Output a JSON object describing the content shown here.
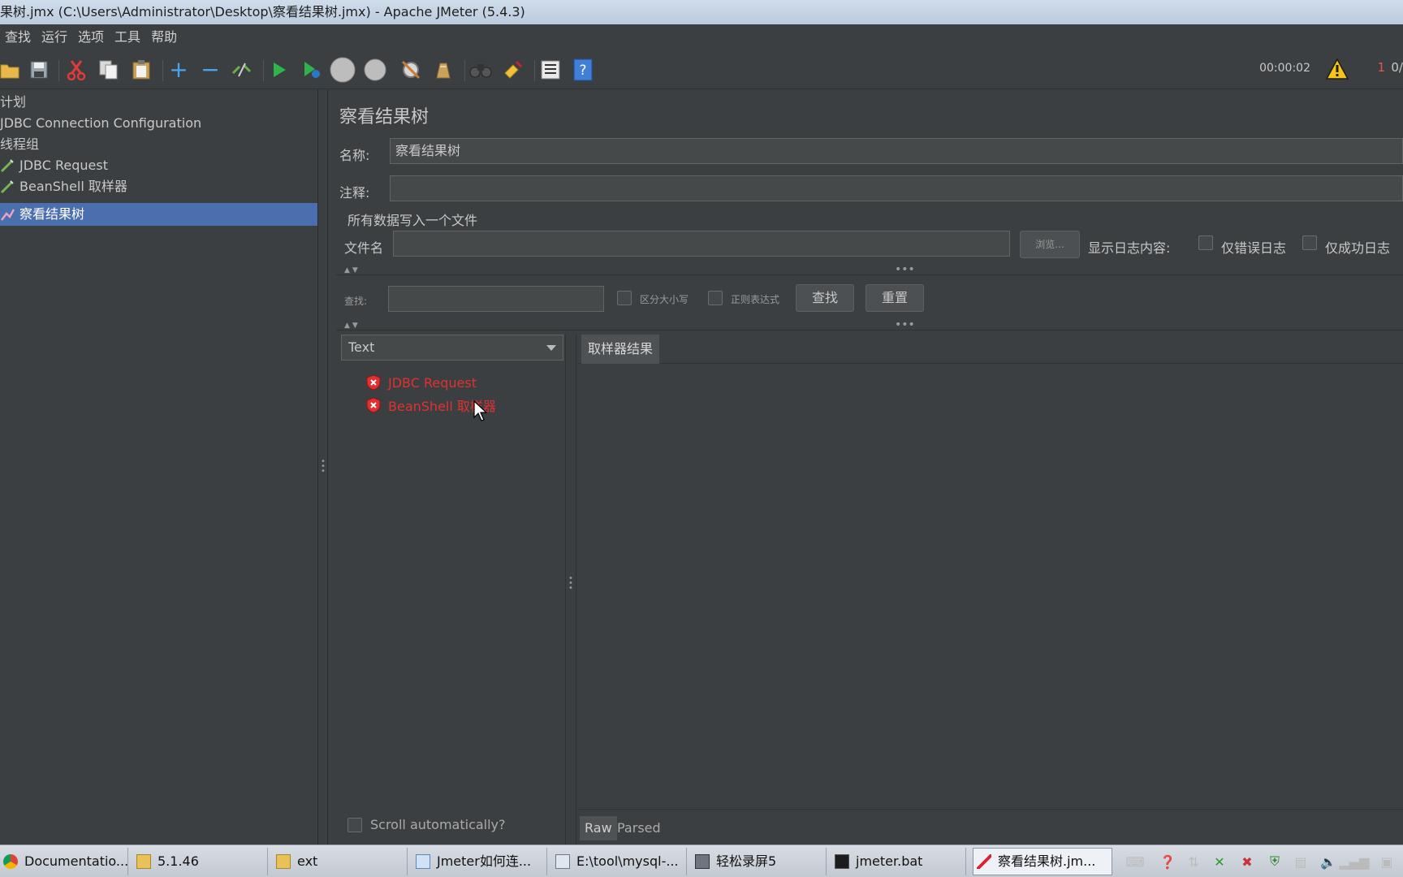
{
  "window": {
    "title": "果树.jmx (C:\\Users\\Administrator\\Desktop\\察看结果树.jmx) - Apache JMeter (5.4.3)"
  },
  "menu": [
    "查找",
    "运行",
    "选项",
    "工具",
    "帮助"
  ],
  "toolbar": {
    "timer": "00:00:02",
    "warn_count": "1",
    "warn_total": "0/"
  },
  "tree": {
    "items": [
      {
        "label": "计划"
      },
      {
        "label": "JDBC Connection Configuration"
      },
      {
        "label": "线程组"
      },
      {
        "label": "JDBC Request"
      },
      {
        "label": "BeanShell 取样器"
      },
      {
        "label": "察看结果树"
      }
    ]
  },
  "panel": {
    "title": "察看结果树",
    "name_label": "名称:",
    "name_value": "察看结果树",
    "comment_label": "注释:",
    "comment_value": "",
    "write_all_label": "所有数据写入一个文件",
    "filename_label": "文件名",
    "filename_value": "",
    "browse_button": "浏览...",
    "log_content_label": "显示日志内容:",
    "errors_only_label": "仅错误日志",
    "success_only_label": "仅成功日志",
    "search_label": "查找:",
    "search_value": "",
    "case_sensitive_label": "区分大小写",
    "regex_label": "正则表达式",
    "find_button": "查找",
    "reset_button": "重置",
    "renderer_selected": "Text",
    "results": [
      {
        "label": "JDBC Request",
        "status": "error"
      },
      {
        "label": "BeanShell 取样器",
        "status": "error"
      }
    ],
    "result_tab": "取样器结果",
    "bottom_tabs": [
      "Raw",
      "Parsed"
    ],
    "scroll_auto_label": "Scroll automatically?"
  },
  "taskbar": {
    "items": [
      {
        "label": "Documentatio..."
      },
      {
        "label": "5.1.46"
      },
      {
        "label": "ext"
      },
      {
        "label": "Jmeter如何连..."
      },
      {
        "label": "E:\\tool\\mysql-..."
      },
      {
        "label": "轻松录屏5"
      },
      {
        "label": "jmeter.bat"
      },
      {
        "label": "察看结果树.jm..."
      }
    ]
  }
}
